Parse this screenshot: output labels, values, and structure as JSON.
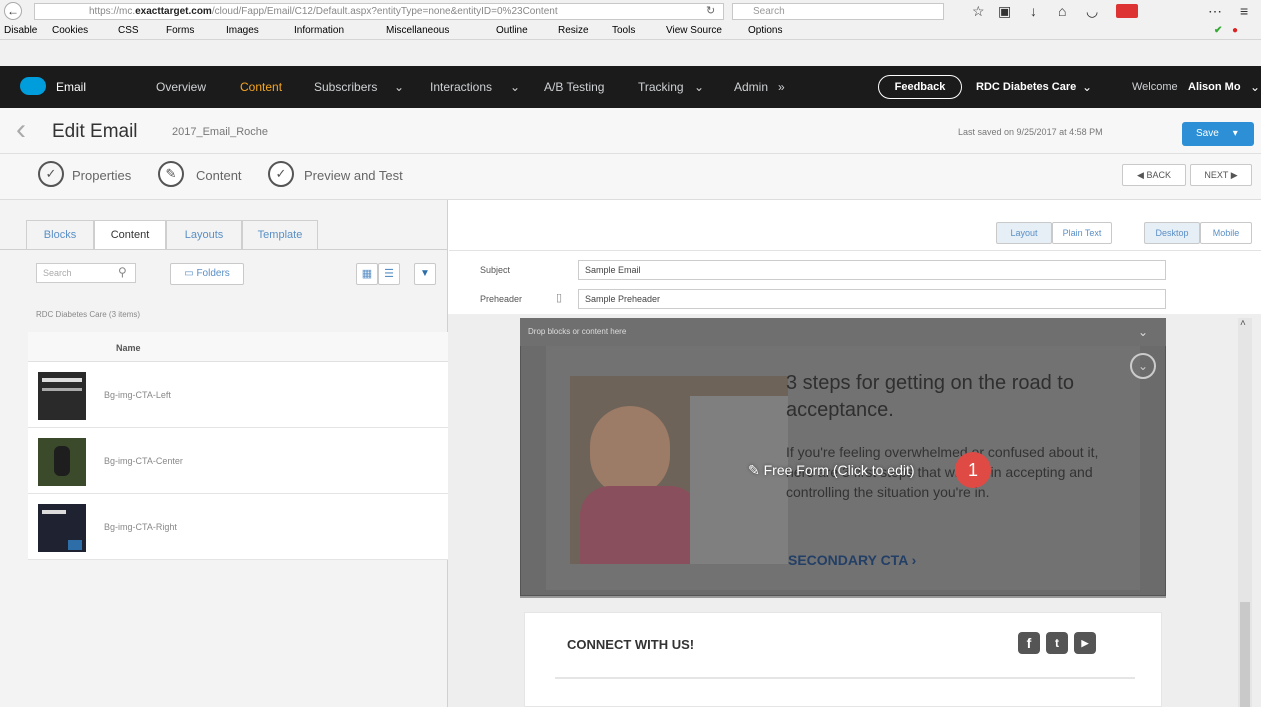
{
  "browser": {
    "url_prefix": "https://mc.",
    "url_domain": "exacttarget.com",
    "url_rest": "/cloud/Fapp/Email/C12/Default.aspx?entityType=none&entityID=0%23Content",
    "search_placeholder": "Search",
    "bookmarks": [
      "Disable",
      "Cookies",
      "CSS",
      "Forms",
      "Images",
      "Information",
      "Miscellaneous",
      "Outline",
      "Resize",
      "Tools",
      "View Source",
      "Options"
    ]
  },
  "appnav": {
    "brand": "Email",
    "items": [
      "Overview",
      "Content",
      "Subscribers",
      "Interactions",
      "A/B Testing",
      "Tracking",
      "Admin"
    ],
    "feedback": "Feedback",
    "account": "RDC Diabetes Care",
    "welcome_prefix": "Welcome",
    "user": "Alison Mo"
  },
  "header": {
    "title": "Edit Email",
    "email_name": "2017_Email_Roche",
    "last_saved": "Last saved on 9/25/2017 at 4:58 PM",
    "save_label": "Save"
  },
  "steps": {
    "properties": "Properties",
    "content": "Content",
    "preview": "Preview and Test",
    "back": "◀ BACK",
    "next": "NEXT ▶"
  },
  "left": {
    "tabs": [
      "Blocks",
      "Content",
      "Layouts",
      "Template"
    ],
    "search_placeholder": "Search",
    "folders_label": "Folders",
    "breadcrumb": "RDC Diabetes Care  (3 items)",
    "col_name": "Name",
    "items": [
      "Bg-img-CTA-Left",
      "Bg-img-CTA-Center",
      "Bg-img-CTA-Right"
    ]
  },
  "right": {
    "view_layout": "Layout",
    "view_plain": "Plain Text",
    "view_desktop": "Desktop",
    "view_mobile": "Mobile",
    "subject_label": "Subject",
    "subject_value": "Sample Email",
    "preheader_label": "Preheader",
    "preheader_value": "Sample Preheader",
    "drop_hint": "Drop blocks or content here",
    "headline": "3 steps for getting on the road to acceptance.",
    "body": "If you're feeling overwhelmed or confused about it, here are 3 first steps that will aid in accepting and controlling the situation you're in.",
    "cta": "SECONDARY CTA ›",
    "overlay": "Free Form (Click to edit)",
    "badge": "1",
    "connect": "CONNECT WITH US!"
  }
}
